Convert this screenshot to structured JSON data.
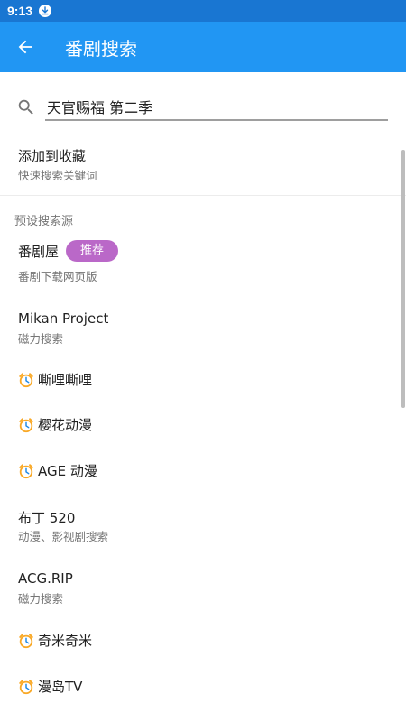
{
  "status_bar": {
    "time": "9:13",
    "download_icon": "download-icon"
  },
  "app_bar": {
    "back_icon": "arrow-back-icon",
    "title": "番剧搜索"
  },
  "search": {
    "icon": "search-icon",
    "value": "天官赐福 第二季",
    "placeholder": ""
  },
  "favorite": {
    "title": "添加到收藏",
    "subtitle": "快速搜索关键词"
  },
  "section": {
    "header": "预设搜索源"
  },
  "sources": [
    {
      "title": "番剧屋",
      "badge": "推荐",
      "subtitle": "番剧下载网页版",
      "icon": ""
    },
    {
      "title": "Mikan Project",
      "subtitle": "磁力搜索",
      "icon": ""
    },
    {
      "title": "嘶哩嘶哩",
      "subtitle": "",
      "icon": "alarm-clock-icon"
    },
    {
      "title": "樱花动漫",
      "subtitle": "",
      "icon": "alarm-clock-icon"
    },
    {
      "title": "AGE 动漫",
      "subtitle": "",
      "icon": "alarm-clock-icon"
    },
    {
      "title": "布丁 520",
      "subtitle": "动漫、影视剧搜索",
      "icon": ""
    },
    {
      "title": "ACG.RIP",
      "subtitle": "磁力搜索",
      "icon": ""
    },
    {
      "title": "奇米奇米",
      "subtitle": "",
      "icon": "alarm-clock-icon"
    },
    {
      "title": "漫岛TV",
      "subtitle": "",
      "icon": "alarm-clock-icon"
    }
  ],
  "colors": {
    "status_bar": "#1976d2",
    "app_bar": "#2196f3",
    "badge": "#ba68c8"
  }
}
